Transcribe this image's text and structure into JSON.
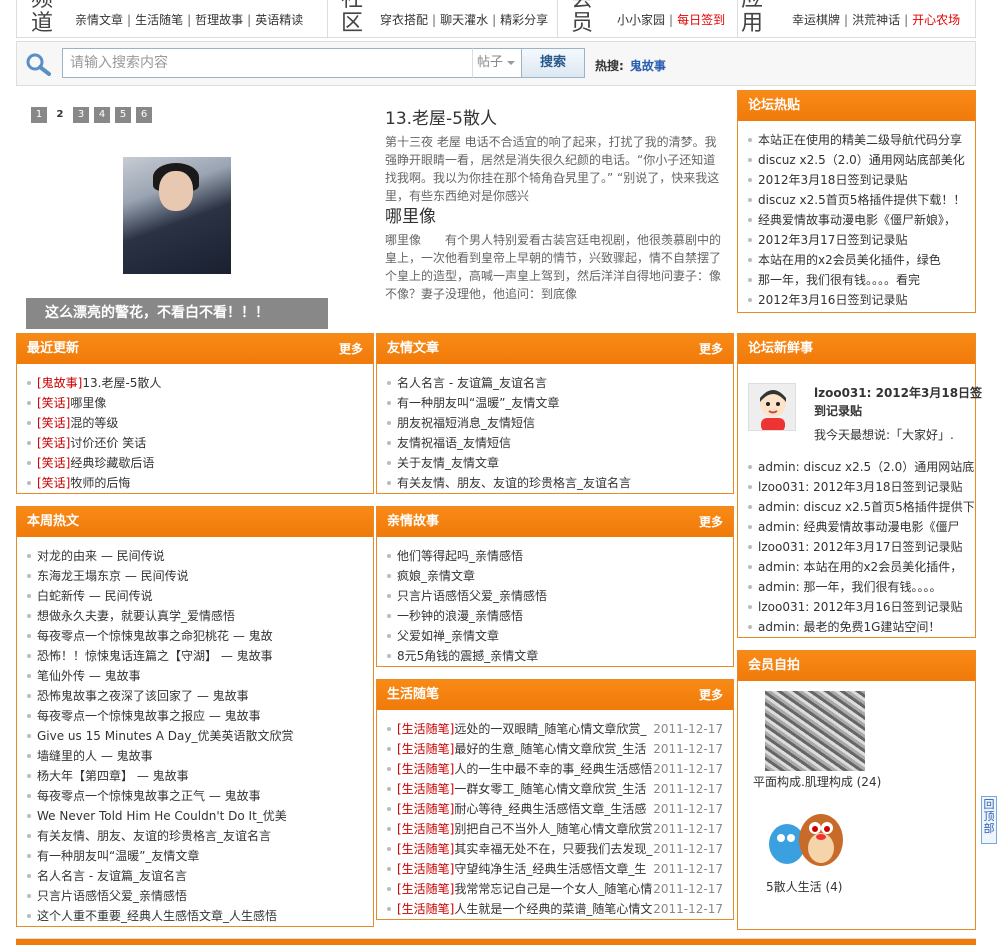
{
  "topnav": {
    "sections": [
      {
        "big": "频道",
        "links": [
          "亲情文章",
          "生活随笔",
          "哲理故事",
          "英语精读"
        ],
        "red": []
      },
      {
        "big": "社区",
        "links": [
          "穿衣搭配",
          "聊天灌水",
          "精彩分享"
        ],
        "red": []
      },
      {
        "big": "会员",
        "links": [
          "小小家园",
          "每日签到"
        ],
        "red": [
          "每日签到"
        ]
      },
      {
        "big": "应用",
        "links": [
          "幸运棋牌",
          "洪荒神话",
          "开心农场"
        ],
        "red": [
          "开心农场"
        ]
      }
    ]
  },
  "search": {
    "placeholder": "请输入搜索内容",
    "type": "帖子",
    "button": "搜索",
    "hot_label": "热搜:",
    "hot_term": "鬼故事"
  },
  "slideshow": {
    "pages": [
      "1",
      "2",
      "3",
      "4",
      "5",
      "6"
    ],
    "current": "2",
    "caption": "这么漂亮的警花，不看白不看！！！"
  },
  "stories": [
    {
      "title": "13.老屋-5散人",
      "body": "第十三夜 老屋 电话不合适宜的响了起来，打扰了我的清梦。我强睁开眼睛一看，居然是消失很久纪颜的电话。“你小子还知道找我啊。我以为你挂在那个犄角旮旯里了。” “别说了，快来我这里，有些东西绝对是你感兴"
    },
    {
      "title": "哪里像",
      "body": "哪里像　　有个男人特别爱看古装宫廷电视剧，他很羡慕剧中的皇上，一次他看到皇帝上早朝的情节，兴致骤起，情不自禁摆了个皇上的造型，高喊一声皇上驾到，然后洋洋自得地问妻子：像不像？妻子没理他，他追问：到底像"
    }
  ],
  "forum_hot": {
    "title": "论坛热贴",
    "items": [
      "本站正在使用的精美二级导航代码分享",
      "discuz x2.5（2.0）通用网站底部美化",
      "2012年3月18日签到记录贴",
      "discuz x2.5首页5格插件提供下载！！",
      "经典爱情故事动漫电影《僵尸新娘》，",
      "2012年3月17日签到记录贴",
      "本站在用的x2会员美化插件，绿色",
      "那一年，我们很有钱。。。。看完",
      "2012年3月16日签到记录贴"
    ]
  },
  "latest": {
    "title": "最近更新",
    "more": "更多",
    "items": [
      {
        "tag": "[鬼故事]",
        "text": "13.老屋-5散人"
      },
      {
        "tag": "[笑话]",
        "text": "哪里像"
      },
      {
        "tag": "[笑话]",
        "text": "混的等级"
      },
      {
        "tag": "[笑话]",
        "text": "讨价还价 笑话"
      },
      {
        "tag": "[笑话]",
        "text": "经典珍藏歇后语"
      },
      {
        "tag": "[笑话]",
        "text": "牧师的后悔"
      }
    ]
  },
  "friendship": {
    "title": "友情文章",
    "more": "更多",
    "items": [
      "名人名言 - 友谊篇_友谊名言",
      "有一种朋友叫“温暖”_友情文章",
      "朋友祝福短消息_友情短信",
      "友情祝福语_友情短信",
      "关于友情_友情文章",
      "有关友情、朋友、友谊的珍贵格言_友谊名言"
    ]
  },
  "forum_news": {
    "title": "论坛新鲜事",
    "feature_title": "lzoo031: 2012年3月18日签到记录贴",
    "feature_quote": "我今天最想说:「大家好」.",
    "items": [
      "admin: discuz x2.5（2.0）通用网站底",
      "lzoo031: 2012年3月18日签到记录贴",
      "admin: discuz x2.5首页5格插件提供下",
      "admin: 经典爱情故事动漫电影《僵尸",
      "lzoo031: 2012年3月17日签到记录贴",
      "admin: 本站在用的x2会员美化插件，",
      "admin: 那一年，我们很有钱。。。。",
      "lzoo031: 2012年3月16日签到记录贴",
      "admin: 最老的免费1G建站空间！"
    ]
  },
  "weekly_hot": {
    "title": "本周热文",
    "items": [
      "对龙的由来 — 民间传说",
      "东海龙王塌东京 — 民间传说",
      "白蛇新传 — 民间传说",
      "想做永久夫妻，就要认真学_爱情感悟",
      "每夜零点一个惊悚鬼故事之命犯桃花 — 鬼故",
      "恐怖！！惊悚鬼话连篇之【守湖】 — 鬼故事",
      "笔仙外传 — 鬼故事",
      "恐怖鬼故事之夜深了该回家了 — 鬼故事",
      "每夜零点一个惊悚鬼故事之报应 — 鬼故事",
      "Give us 15 Minutes A Day_优美英语散文欣赏",
      "墙缝里的人 — 鬼故事",
      "杨大年【第四章】 — 鬼故事",
      "每夜零点一个惊悚鬼故事之正气 — 鬼故事",
      "We Never Told Him He Couldn't Do It_优美",
      "有关友情、朋友、友谊的珍贵格言_友谊名言",
      "有一种朋友叫“温暖”_友情文章",
      "名人名言 - 友谊篇_友谊名言",
      "只言片语感悟父爱_亲情感悟",
      "这个人重不重要_经典人生感悟文章_人生感悟"
    ]
  },
  "family": {
    "title": "亲情故事",
    "more": "更多",
    "items": [
      "他们等得起吗_亲情感悟",
      "疯娘_亲情文章",
      "只言片语感悟父爱_亲情感悟",
      "一秒钟的浪漫_亲情感悟",
      "父爱如禅_亲情文章",
      "8元5角钱的震撼_亲情文章"
    ]
  },
  "life": {
    "title": "生活随笔",
    "more": "更多",
    "items": [
      {
        "tag": "[生活随笔]",
        "text": "远处的一双眼睛_随笔心情文章欣赏_",
        "date": "2011-12-17"
      },
      {
        "tag": "[生活随笔]",
        "text": "最好的生意_随笔心情文章欣赏_生活",
        "date": "2011-12-17"
      },
      {
        "tag": "[生活随笔]",
        "text": "人的一生中最不幸的事_经典生活感悟",
        "date": "2011-12-17"
      },
      {
        "tag": "[生活随笔]",
        "text": "一群女零工_随笔心情文章欣赏_生活",
        "date": "2011-12-17"
      },
      {
        "tag": "[生活随笔]",
        "text": "耐心等待_经典生活感悟文章_生活感",
        "date": "2011-12-17"
      },
      {
        "tag": "[生活随笔]",
        "text": "别把自己不当外人_随笔心情文章欣赏",
        "date": "2011-12-17"
      },
      {
        "tag": "[生活随笔]",
        "text": "其实幸福无处不在，只要我们去发现_",
        "date": "2011-12-17"
      },
      {
        "tag": "[生活随笔]",
        "text": "守望纯净生活_经典生活感悟文章_生",
        "date": "2011-12-17"
      },
      {
        "tag": "[生活随笔]",
        "text": "我常常忘记自己是一个女人_随笔心情",
        "date": "2011-12-17"
      },
      {
        "tag": "[生活随笔]",
        "text": "人生就是一个经典的菜谱_随笔心情文",
        "date": "2011-12-17"
      }
    ]
  },
  "member_photos": {
    "title": "会员自拍",
    "items": [
      "平面构成.肌理构成 (24)",
      "5散人生活 (4)"
    ]
  },
  "back_to_top": "回顶部"
}
